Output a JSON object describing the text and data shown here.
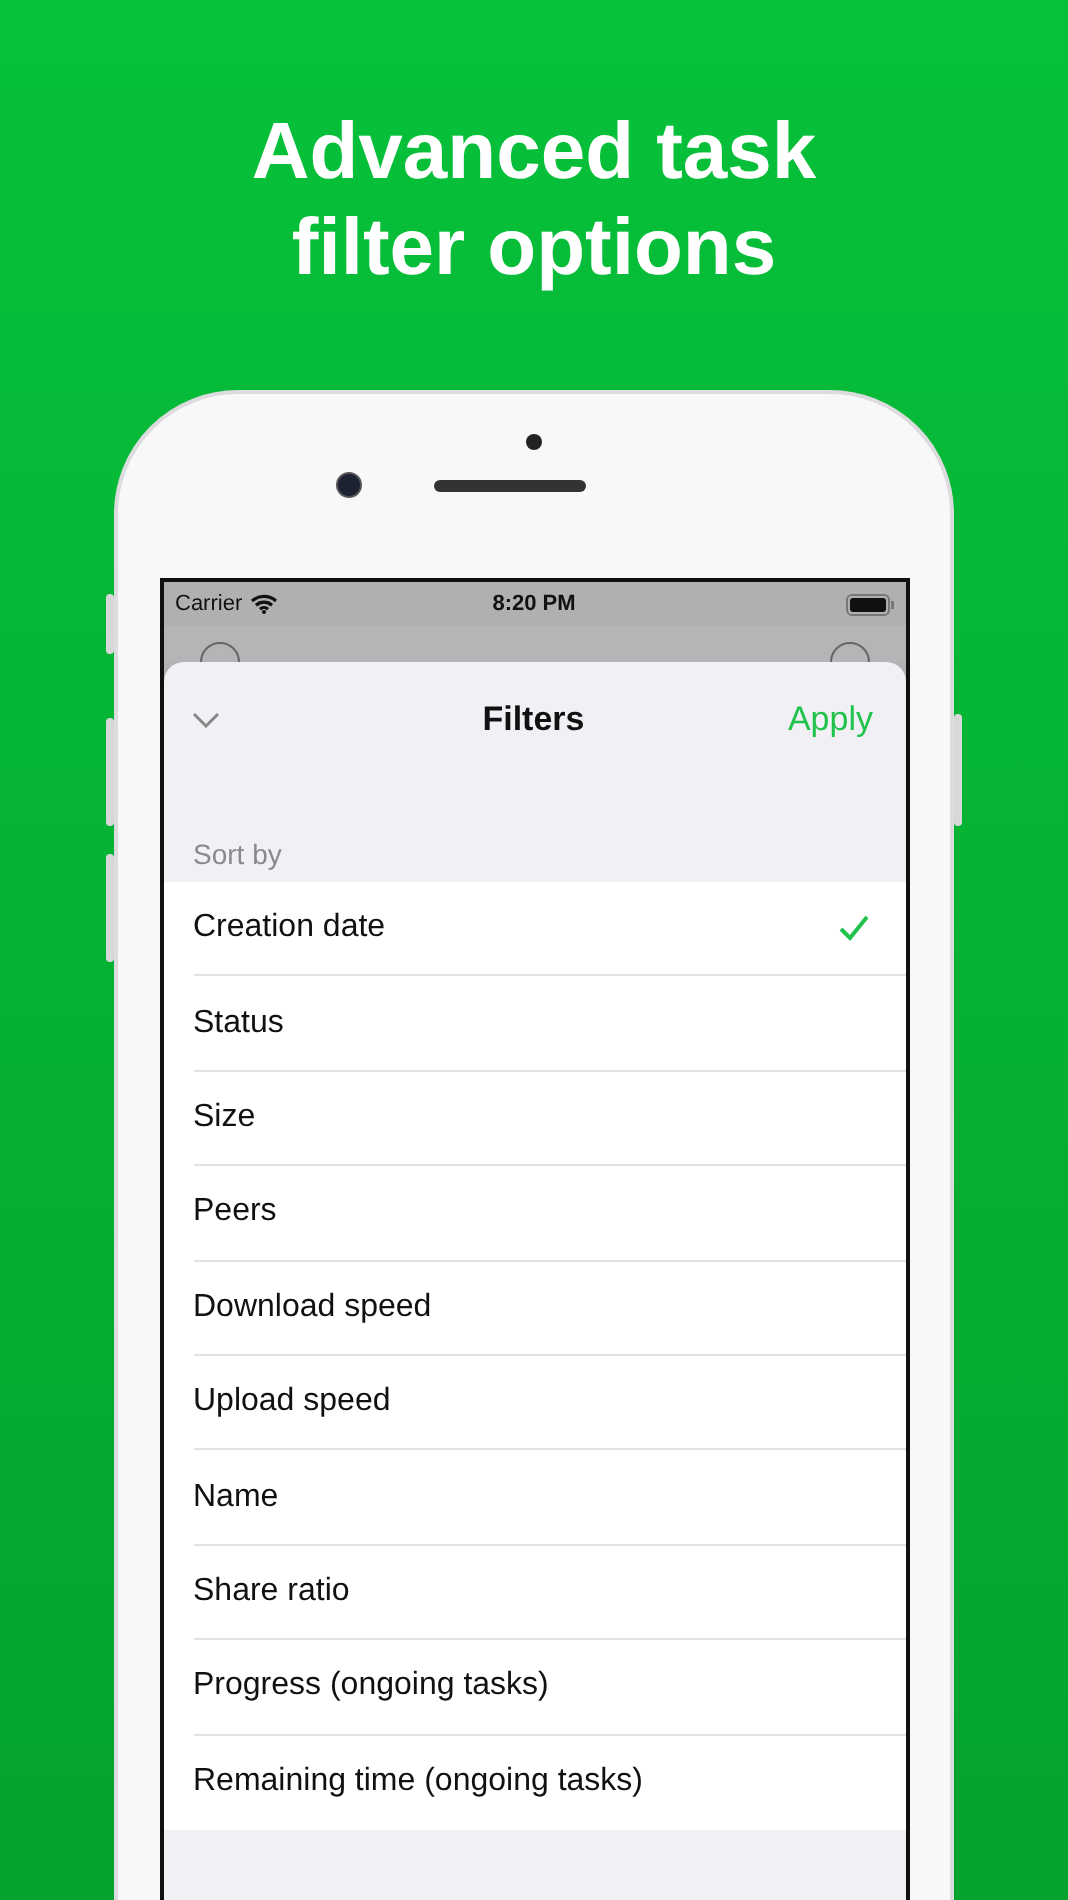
{
  "headline": "Advanced task filter options",
  "status_bar": {
    "carrier": "Carrier",
    "time": "8:20 PM"
  },
  "sheet": {
    "title": "Filters",
    "action": "Apply"
  },
  "section": "Sort by",
  "options": [
    {
      "label": "Creation date",
      "selected": true
    },
    {
      "label": "Status",
      "selected": false
    },
    {
      "label": "Size",
      "selected": false
    },
    {
      "label": "Peers",
      "selected": false
    },
    {
      "label": "Download speed",
      "selected": false
    },
    {
      "label": "Upload speed",
      "selected": false
    },
    {
      "label": "Name",
      "selected": false
    },
    {
      "label": "Share ratio",
      "selected": false
    },
    {
      "label": "Progress (ongoing tasks)",
      "selected": false
    },
    {
      "label": "Remaining time (ongoing tasks)",
      "selected": false
    }
  ]
}
